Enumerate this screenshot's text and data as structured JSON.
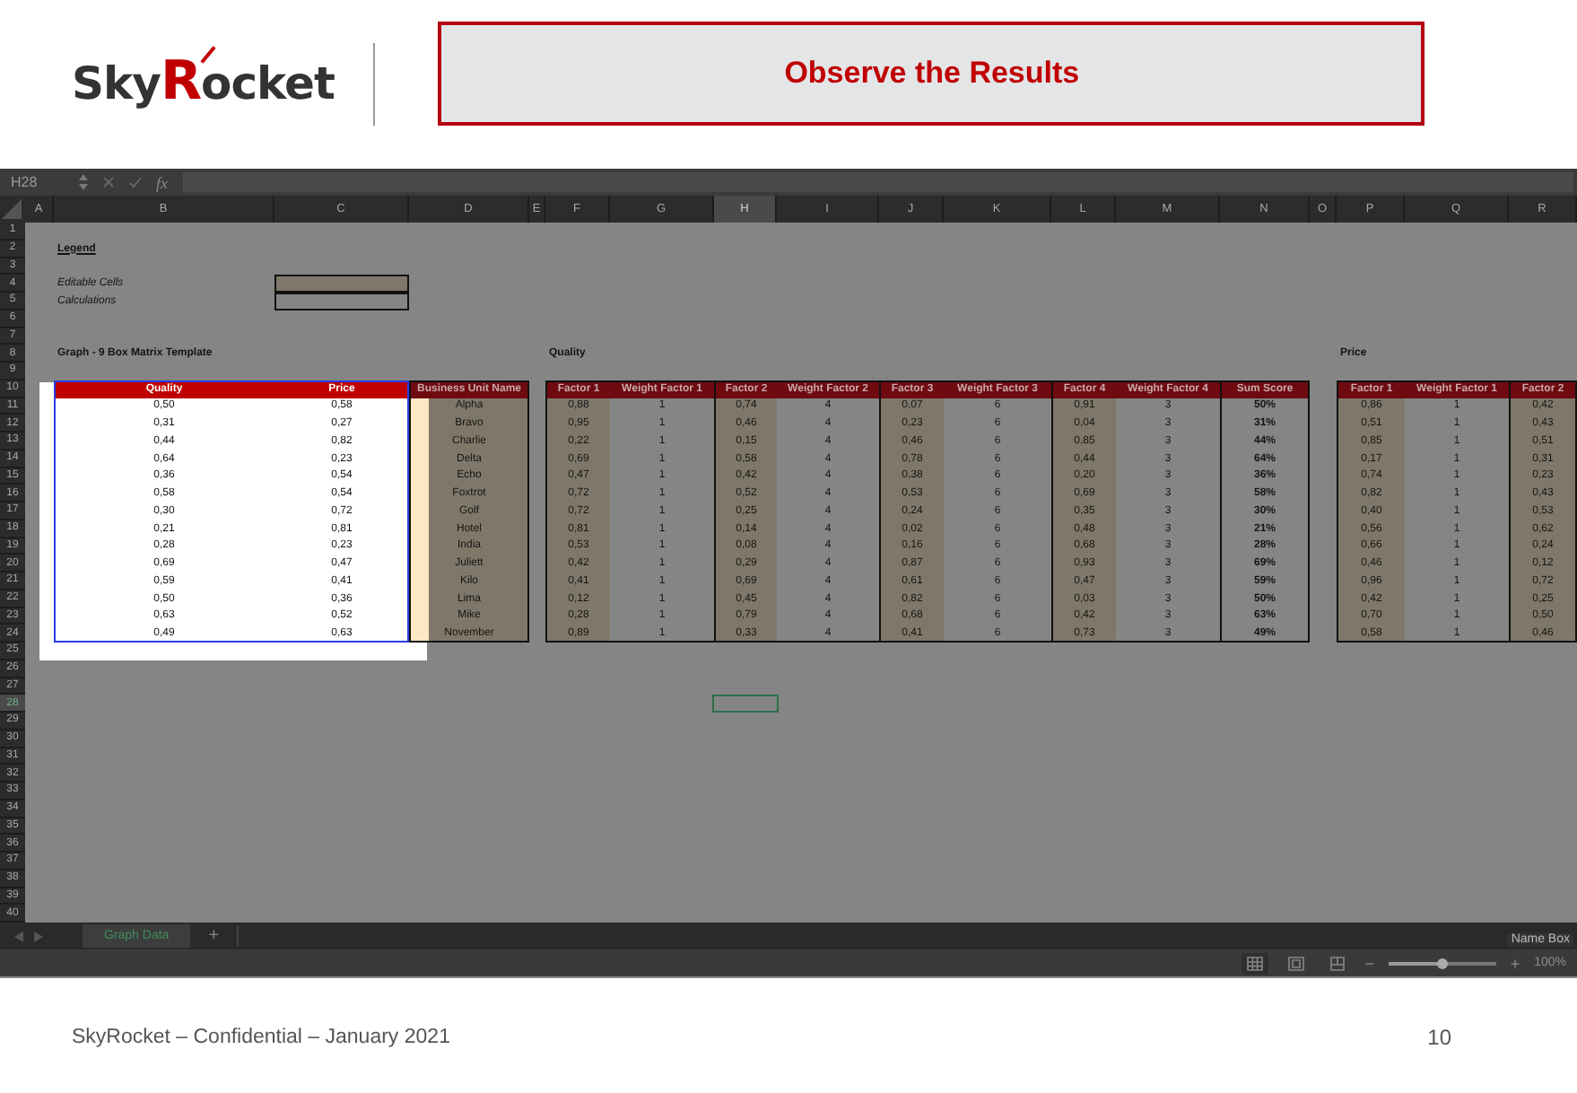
{
  "header": {
    "logo": [
      {
        "text": "Sky",
        "accent": false
      },
      {
        "text": "R",
        "accent": true
      },
      {
        "text": "ocket",
        "accent": false
      }
    ],
    "title": "Observe the Results"
  },
  "excel": {
    "formula_bar": {
      "name_box": "H28",
      "function_label": "fx"
    },
    "columns": [
      {
        "label": "A",
        "selected": false
      },
      {
        "label": "B",
        "selected": false
      },
      {
        "label": "C",
        "selected": false
      },
      {
        "label": "D",
        "selected": false
      },
      {
        "label": "E",
        "selected": false
      },
      {
        "label": "F",
        "selected": false
      },
      {
        "label": "G",
        "selected": false
      },
      {
        "label": "H",
        "selected": true
      },
      {
        "label": "I",
        "selected": false
      },
      {
        "label": "J",
        "selected": false
      },
      {
        "label": "K",
        "selected": false
      },
      {
        "label": "L",
        "selected": false
      },
      {
        "label": "M",
        "selected": false
      },
      {
        "label": "N",
        "selected": false
      },
      {
        "label": "O",
        "selected": false
      },
      {
        "label": "P",
        "selected": false
      },
      {
        "label": "Q",
        "selected": false
      },
      {
        "label": "R",
        "selected": false
      }
    ],
    "rows": [
      {
        "label": "1",
        "selected": false
      },
      {
        "label": "2",
        "selected": false
      },
      {
        "label": "3",
        "selected": false
      },
      {
        "label": "4",
        "selected": false
      },
      {
        "label": "5",
        "selected": false
      },
      {
        "label": "6",
        "selected": false
      },
      {
        "label": "7",
        "selected": false
      },
      {
        "label": "8",
        "selected": false
      },
      {
        "label": "9",
        "selected": false
      },
      {
        "label": "10",
        "selected": false
      },
      {
        "label": "11",
        "selected": false
      },
      {
        "label": "12",
        "selected": false
      },
      {
        "label": "13",
        "selected": false
      },
      {
        "label": "14",
        "selected": false
      },
      {
        "label": "15",
        "selected": false
      },
      {
        "label": "16",
        "selected": false
      },
      {
        "label": "17",
        "selected": false
      },
      {
        "label": "18",
        "selected": false
      },
      {
        "label": "19",
        "selected": false
      },
      {
        "label": "20",
        "selected": false
      },
      {
        "label": "21",
        "selected": false
      },
      {
        "label": "22",
        "selected": false
      },
      {
        "label": "23",
        "selected": false
      },
      {
        "label": "24",
        "selected": false
      },
      {
        "label": "25",
        "selected": false
      },
      {
        "label": "26",
        "selected": false
      },
      {
        "label": "27",
        "selected": false
      },
      {
        "label": "28",
        "selected": true
      },
      {
        "label": "29",
        "selected": false
      },
      {
        "label": "30",
        "selected": false
      },
      {
        "label": "31",
        "selected": false
      },
      {
        "label": "32",
        "selected": false
      },
      {
        "label": "33",
        "selected": false
      },
      {
        "label": "34",
        "selected": false
      },
      {
        "label": "35",
        "selected": false
      },
      {
        "label": "36",
        "selected": false
      },
      {
        "label": "37",
        "selected": false
      },
      {
        "label": "38",
        "selected": false
      },
      {
        "label": "39",
        "selected": false
      },
      {
        "label": "40",
        "selected": false
      }
    ],
    "legend": {
      "title": "Legend",
      "items": [
        {
          "label": "Editable Cells",
          "kind": "editable"
        },
        {
          "label": "Calculations",
          "kind": "calculation"
        }
      ]
    },
    "graph_title": "Graph - 9 Box Matrix Template",
    "graph_table": {
      "columns": [
        "Quality",
        "Price"
      ],
      "rows": [
        [
          "0,50",
          "0,58"
        ],
        [
          "0,31",
          "0,27"
        ],
        [
          "0,44",
          "0,82"
        ],
        [
          "0,64",
          "0,23"
        ],
        [
          "0,36",
          "0,54"
        ],
        [
          "0,58",
          "0,54"
        ],
        [
          "0,30",
          "0,72"
        ],
        [
          "0,21",
          "0,81"
        ],
        [
          "0,28",
          "0,23"
        ],
        [
          "0,69",
          "0,47"
        ],
        [
          "0,59",
          "0,41"
        ],
        [
          "0,50",
          "0,36"
        ],
        [
          "0,63",
          "0,52"
        ],
        [
          "0,49",
          "0,63"
        ]
      ]
    },
    "business_units": {
      "header": "Business Unit Name",
      "names": [
        "Alpha",
        "Bravo",
        "Charlie",
        "Delta",
        "Echo",
        "Foxtrot",
        "Golf",
        "Hotel",
        "India",
        "Juliett",
        "Kilo",
        "Lima",
        "Mike",
        "November"
      ]
    },
    "quality": {
      "title": "Quality",
      "columns": [
        {
          "label": "Factor 1",
          "kind": "editable"
        },
        {
          "label": "Weight Factor 1",
          "kind": "calculation"
        },
        {
          "label": "Factor 2",
          "kind": "editable"
        },
        {
          "label": "Weight Factor 2",
          "kind": "calculation"
        },
        {
          "label": "Factor 3",
          "kind": "editable"
        },
        {
          "label": "Weight Factor 3",
          "kind": "calculation"
        },
        {
          "label": "Factor 4",
          "kind": "editable"
        },
        {
          "label": "Weight Factor 4",
          "kind": "calculation"
        },
        {
          "label": "Sum Score",
          "kind": "score"
        }
      ],
      "rows": [
        [
          "0,88",
          "1",
          "0,74",
          "4",
          "0,07",
          "6",
          "0,91",
          "3",
          "50%"
        ],
        [
          "0,95",
          "1",
          "0,46",
          "4",
          "0,23",
          "6",
          "0,04",
          "3",
          "31%"
        ],
        [
          "0,22",
          "1",
          "0,15",
          "4",
          "0,46",
          "6",
          "0,85",
          "3",
          "44%"
        ],
        [
          "0,69",
          "1",
          "0,58",
          "4",
          "0,78",
          "6",
          "0,44",
          "3",
          "64%"
        ],
        [
          "0,47",
          "1",
          "0,42",
          "4",
          "0,38",
          "6",
          "0,20",
          "3",
          "36%"
        ],
        [
          "0,72",
          "1",
          "0,52",
          "4",
          "0,53",
          "6",
          "0,69",
          "3",
          "58%"
        ],
        [
          "0,72",
          "1",
          "0,25",
          "4",
          "0,24",
          "6",
          "0,35",
          "3",
          "30%"
        ],
        [
          "0,81",
          "1",
          "0,14",
          "4",
          "0,02",
          "6",
          "0,48",
          "3",
          "21%"
        ],
        [
          "0,53",
          "1",
          "0,08",
          "4",
          "0,16",
          "6",
          "0,68",
          "3",
          "28%"
        ],
        [
          "0,42",
          "1",
          "0,29",
          "4",
          "0,87",
          "6",
          "0,93",
          "3",
          "69%"
        ],
        [
          "0,41",
          "1",
          "0,69",
          "4",
          "0,61",
          "6",
          "0,47",
          "3",
          "59%"
        ],
        [
          "0,12",
          "1",
          "0,45",
          "4",
          "0,82",
          "6",
          "0,03",
          "3",
          "50%"
        ],
        [
          "0,28",
          "1",
          "0,79",
          "4",
          "0,68",
          "6",
          "0,42",
          "3",
          "63%"
        ],
        [
          "0,89",
          "1",
          "0,33",
          "4",
          "0,41",
          "6",
          "0,73",
          "3",
          "49%"
        ]
      ]
    },
    "price": {
      "title": "Price",
      "columns": [
        {
          "label": "Factor 1",
          "kind": "editable"
        },
        {
          "label": "Weight Factor 1",
          "kind": "calculation"
        },
        {
          "label": "Factor 2",
          "kind": "editable"
        }
      ],
      "rows": [
        [
          "0,86",
          "1",
          "0,42"
        ],
        [
          "0,51",
          "1",
          "0,43"
        ],
        [
          "0,85",
          "1",
          "0,51"
        ],
        [
          "0,17",
          "1",
          "0,31"
        ],
        [
          "0,74",
          "1",
          "0,23"
        ],
        [
          "0,82",
          "1",
          "0,43"
        ],
        [
          "0,40",
          "1",
          "0,53"
        ],
        [
          "0,56",
          "1",
          "0,62"
        ],
        [
          "0,66",
          "1",
          "0,24"
        ],
        [
          "0,46",
          "1",
          "0,12"
        ],
        [
          "0,96",
          "1",
          "0,72"
        ],
        [
          "0,42",
          "1",
          "0,25"
        ],
        [
          "0,70",
          "1",
          "0,50"
        ],
        [
          "0,58",
          "1",
          "0,46"
        ]
      ]
    },
    "sheet_tabs": [
      {
        "label": "Graph Data",
        "selected": true
      }
    ],
    "add_sheet": "+",
    "status": {
      "tooltip": "Name Box",
      "minus": "−",
      "plus": "+",
      "zoom": {
        "level": 0.5,
        "reading": "100%"
      }
    }
  },
  "footer": {
    "text": "SkyRocket – Confidential – January 2021",
    "page": "10"
  }
}
